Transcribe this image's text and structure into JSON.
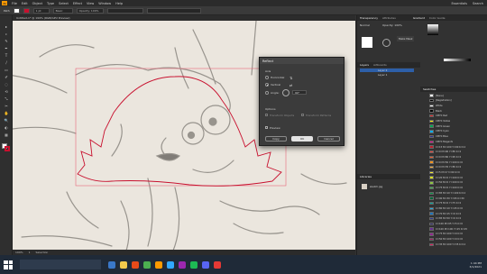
{
  "menubar": {
    "logo": "Ai",
    "items": [
      "File",
      "Edit",
      "Object",
      "Type",
      "Select",
      "Effect",
      "View",
      "Window",
      "Help"
    ],
    "right": [
      "Essentials",
      "Search"
    ]
  },
  "control_bar": {
    "mode": "Path",
    "stroke": "1 pt",
    "style": "Basic",
    "opacity": "Opacity: 100%"
  },
  "document_tab": "Untitled-1* @ 199% (RGB/GPU Preview)",
  "tools": [
    "▸",
    "▹",
    "✎",
    "✒",
    "T",
    "/",
    "▭",
    "✐",
    "◌",
    "⟲",
    "⤡",
    "✂",
    "✋",
    "🔍",
    "◐",
    "▦"
  ],
  "panels": {
    "top_tabs": [
      "Transparency",
      "Attributes",
      "Gradient",
      "Color Guide"
    ],
    "transparency": {
      "mode": "Normal",
      "opacity": "Opacity: 100%",
      "make_mask": "Make Mask"
    },
    "layers_tabs": [
      "Layers",
      "Artboards"
    ],
    "layers": [
      "Layer 2",
      "Layer 1"
    ],
    "libraries_tab": "Libraries",
    "libraries_item": "sketch.jpg",
    "swatches_tab": "Swatches",
    "swatch_rows": [
      "[None]",
      "[Registration]",
      "White",
      "Black",
      "CMYK Red",
      "CMYK Yellow",
      "CMYK Green",
      "CMYK Cyan",
      "CMYK Blue",
      "CMYK Magenta",
      "C=15 M=100 Y=90 K=10",
      "C=0 M=90 Y=85 K=0",
      "C=0 M=80 Y=95 K=0",
      "C=0 M=50 Y=100 K=0",
      "C=0 M=35 Y=85 K=0",
      "C=5 M=0 Y=90 K=0",
      "C=20 M=0 Y=100 K=0",
      "C=50 M=0 Y=100 K=0",
      "C=75 M=0 Y=100 K=0",
      "C=85 M=10 Y=100 K=10",
      "C=90 M=30 Y=95 K=30",
      "C=75 M=0 Y=75 K=0",
      "C=80 M=10 Y=45 K=0",
      "C=70 M=15 Y=0 K=0",
      "C=85 M=50 Y=0 K=0",
      "C=100 M=95 Y=5 K=0",
      "C=100 M=100 Y=25 K=25",
      "C=75 M=100 Y=0 K=0",
      "C=50 M=100 Y=0 K=0",
      "C=35 M=100 Y=35 K=10"
    ],
    "swatch_colors": [
      "#ffffff",
      "#000000",
      "#ffffff",
      "#000000",
      "#e32222",
      "#fff200",
      "#00a651",
      "#00aeef",
      "#2e3192",
      "#ec008c",
      "#be1e2d",
      "#ef4136",
      "#f15a29",
      "#f7941d",
      "#fbb040",
      "#f9ed32",
      "#d7df23",
      "#8dc63f",
      "#39b54a",
      "#009444",
      "#006838",
      "#00a79d",
      "#27aae1",
      "#1c75bc",
      "#2b3990",
      "#262262",
      "#662d91",
      "#92278f",
      "#9e1f63",
      "#da1c5c"
    ]
  },
  "dialog": {
    "title": "Reflect",
    "axis_label": "Axis",
    "horizontal": "Horizontal",
    "vertical": "Vertical",
    "angle_label": "Angle:",
    "angle_value": "90°",
    "options_label": "Options",
    "transform_objects": "Transform Objects",
    "transform_patterns": "Transform Patterns",
    "preview": "Preview",
    "copy": "Copy",
    "ok": "OK",
    "cancel": "Cancel"
  },
  "statusbar": {
    "zoom": "199%",
    "page": "1",
    "tool": "Selection"
  },
  "taskbar": {
    "time": "1:44 PM",
    "date": "3/1/2021"
  },
  "colors": {
    "accent": "#ff9a00",
    "selection_path": "#c8102e",
    "bbox": "#e8677a"
  }
}
